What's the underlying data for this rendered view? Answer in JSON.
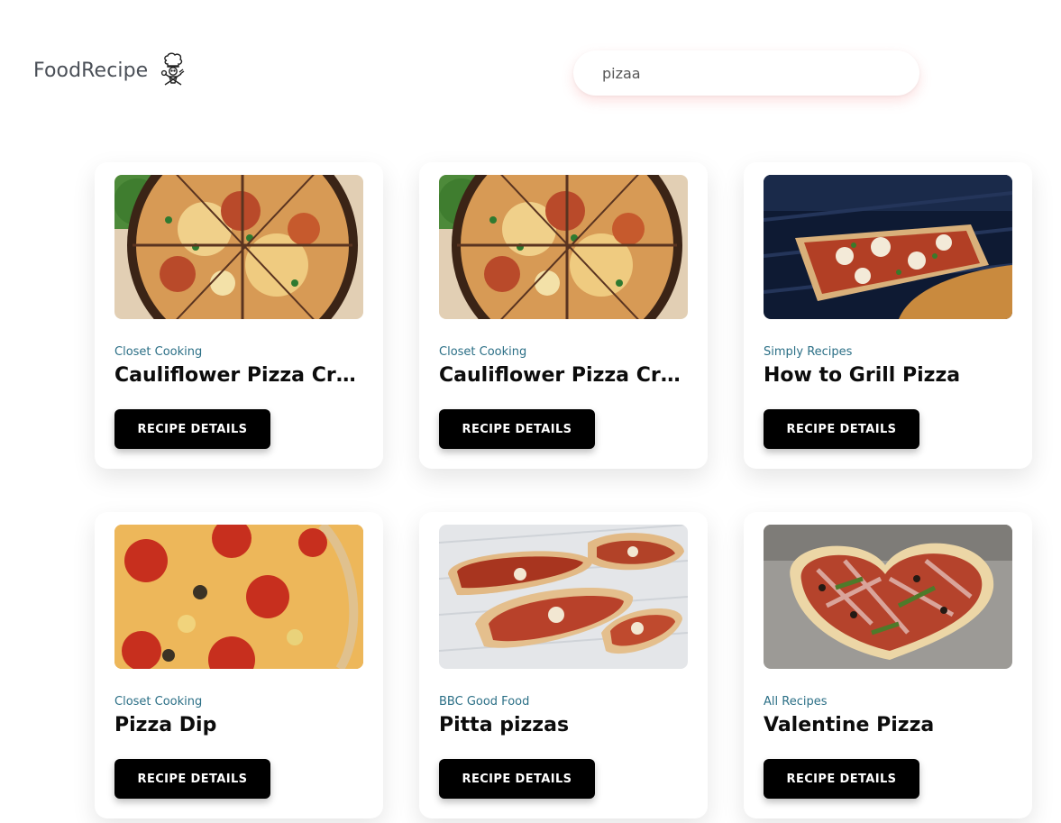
{
  "header": {
    "brand": "FoodRecipe",
    "brand_icon": "chef-icon",
    "search_value": "pizaa"
  },
  "recipes": [
    {
      "publisher": "Closet Cooking",
      "title": "Cauliflower Pizza Crust (with BBQ Chicken Pizza)",
      "button_label": "RECIPE DETAILS",
      "image": "bbq-chicken-pizza-photo"
    },
    {
      "publisher": "Closet Cooking",
      "title": "Cauliflower Pizza Crust (with BBQ Chicken Pizza)",
      "button_label": "RECIPE DETAILS",
      "image": "bbq-chicken-pizza-photo"
    },
    {
      "publisher": "Simply Recipes",
      "title": "How to Grill Pizza",
      "button_label": "RECIPE DETAILS",
      "image": "grilled-pizza-photo"
    },
    {
      "publisher": "Closet Cooking",
      "title": "Pizza Dip",
      "button_label": "RECIPE DETAILS",
      "image": "pizza-dip-photo"
    },
    {
      "publisher": "BBC Good Food",
      "title": "Pitta pizzas",
      "button_label": "RECIPE DETAILS",
      "image": "pitta-pizzas-photo"
    },
    {
      "publisher": "All Recipes",
      "title": "Valentine Pizza",
      "button_label": "RECIPE DETAILS",
      "image": "valentine-pizza-photo"
    }
  ],
  "colors": {
    "publisher_text": "#2b6f86",
    "button_bg": "#000000",
    "brand_text": "#4a4f57"
  }
}
